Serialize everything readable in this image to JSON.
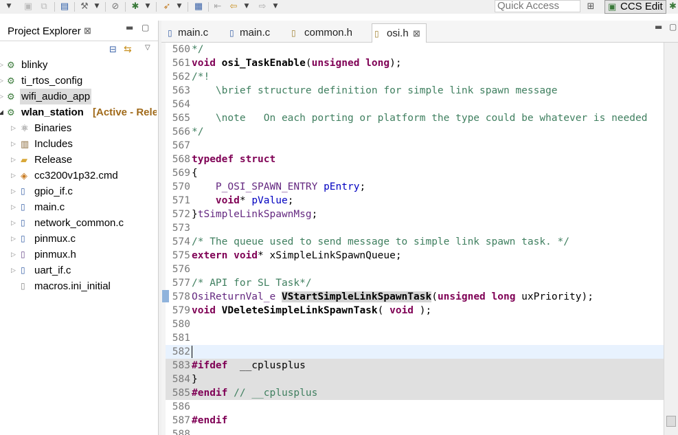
{
  "toolbar": {
    "quick_access_placeholder": "Quick Access",
    "perspective_label": "CCS Edit"
  },
  "project_explorer": {
    "title": "Project Explorer",
    "close_glyph": "⊠",
    "tree": [
      {
        "label": "blinky",
        "icon": "project-icon",
        "bold": false,
        "selected": false
      },
      {
        "label": "ti_rtos_config",
        "icon": "rtsc-project-icon",
        "bold": false,
        "selected": false
      },
      {
        "label": "wifi_audio_app",
        "icon": "project-icon",
        "bold": false,
        "selected": true
      },
      {
        "label": "wlan_station",
        "icon": "project-icon",
        "bold": true,
        "selected": false,
        "suffix": "[Active - Rele"
      },
      {
        "label": "Binaries",
        "icon": "binaries-icon"
      },
      {
        "label": "Includes",
        "icon": "includes-icon"
      },
      {
        "label": "Release",
        "icon": "folder-icon"
      },
      {
        "label": "cc3200v1p32.cmd",
        "icon": "linker-file-icon"
      },
      {
        "label": "gpio_if.c",
        "icon": "c-file-icon"
      },
      {
        "label": "main.c",
        "icon": "c-file-icon"
      },
      {
        "label": "network_common.c",
        "icon": "c-file-icon"
      },
      {
        "label": "pinmux.c",
        "icon": "c-file-icon"
      },
      {
        "label": "pinmux.h",
        "icon": "h-file-icon"
      },
      {
        "label": "uart_if.c",
        "icon": "c-file-icon"
      },
      {
        "label": "macros.ini_initial",
        "icon": "text-file-icon"
      }
    ]
  },
  "editor": {
    "tabs": [
      {
        "label": "main.c",
        "icon": "c-file-icon",
        "active": false
      },
      {
        "label": "main.c",
        "icon": "c-file-icon",
        "active": false
      },
      {
        "label": "common.h",
        "icon": "h-file-icon",
        "active": false
      },
      {
        "label": "osi.h",
        "icon": "h-file-icon",
        "active": true
      }
    ],
    "lines": [
      {
        "n": "560",
        "text": "*/"
      },
      {
        "n": "561",
        "text": "void osi_TaskEnable(unsigned long);"
      },
      {
        "n": "562",
        "text": "/*!"
      },
      {
        "n": "563",
        "text": "    \\brief structure definition for simple link spawn message"
      },
      {
        "n": "564",
        "text": ""
      },
      {
        "n": "565",
        "text": "    \\note   On each porting or platform the type could be whatever is needed"
      },
      {
        "n": "566",
        "text": "*/"
      },
      {
        "n": "567",
        "text": ""
      },
      {
        "n": "568",
        "text": "typedef struct"
      },
      {
        "n": "569",
        "text": "{"
      },
      {
        "n": "570",
        "text": "    P_OSI_SPAWN_ENTRY pEntry;"
      },
      {
        "n": "571",
        "text": "    void* pValue;"
      },
      {
        "n": "572",
        "text": "}tSimpleLinkSpawnMsg;"
      },
      {
        "n": "573",
        "text": ""
      },
      {
        "n": "574",
        "text": "/* The queue used to send message to simple link spawn task. */"
      },
      {
        "n": "575",
        "text": "extern void* xSimpleLinkSpawnQueue;"
      },
      {
        "n": "576",
        "text": ""
      },
      {
        "n": "577",
        "text": "/* API for SL Task*/"
      },
      {
        "n": "578",
        "text": "OsiReturnVal_e VStartSimpleLinkSpawnTask(unsigned long uxPriority);"
      },
      {
        "n": "579",
        "text": "void VDeleteSimpleLinkSpawnTask( void );"
      },
      {
        "n": "580",
        "text": ""
      },
      {
        "n": "581",
        "text": ""
      },
      {
        "n": "582",
        "text": ""
      },
      {
        "n": "583",
        "text": "#ifdef  __cplusplus"
      },
      {
        "n": "584",
        "text": "}"
      },
      {
        "n": "585",
        "text": "#endif // __cplusplus"
      },
      {
        "n": "586",
        "text": ""
      },
      {
        "n": "587",
        "text": "#endif"
      },
      {
        "n": "588",
        "text": ""
      }
    ]
  }
}
